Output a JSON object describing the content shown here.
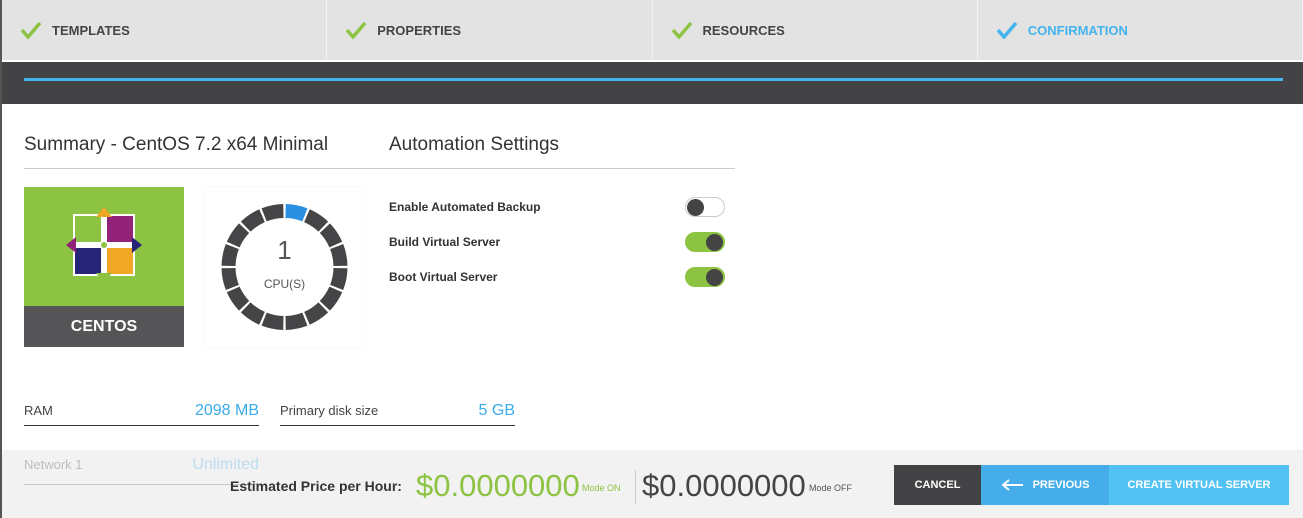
{
  "steps": [
    {
      "label": "TEMPLATES",
      "state": "done"
    },
    {
      "label": "PROPERTIES",
      "state": "done"
    },
    {
      "label": "RESOURCES",
      "state": "done"
    },
    {
      "label": "CONFIRMATION",
      "state": "active"
    }
  ],
  "summary": {
    "title": "Summary - CentOS 7.2 x64 Minimal",
    "os_label": "CENTOS",
    "cpu_count": "1",
    "cpu_label": "CPU(S)"
  },
  "automation": {
    "title": "Automation Settings",
    "toggles": [
      {
        "label": "Enable Automated Backup",
        "on": false
      },
      {
        "label": "Build Virtual Server",
        "on": true
      },
      {
        "label": "Boot Virtual Server",
        "on": true
      }
    ]
  },
  "resources": {
    "ram_label": "RAM",
    "ram_value": "2098 MB",
    "disk_label": "Primary disk size",
    "disk_value": "5 GB",
    "network_label": "Network 1",
    "network_value": "Unlimited"
  },
  "footer": {
    "price_label": "Estimated Price per Hour:",
    "price_on": "$0.0000000",
    "mode_on": "Mode ON",
    "price_off": "$0.0000000",
    "mode_off": "Mode OFF",
    "cancel": "CANCEL",
    "previous": "PREVIOUS",
    "create": "CREATE VIRTUAL SERVER"
  },
  "colors": {
    "green": "#8dc343",
    "blue": "#45b3ee",
    "dark": "#434345"
  }
}
